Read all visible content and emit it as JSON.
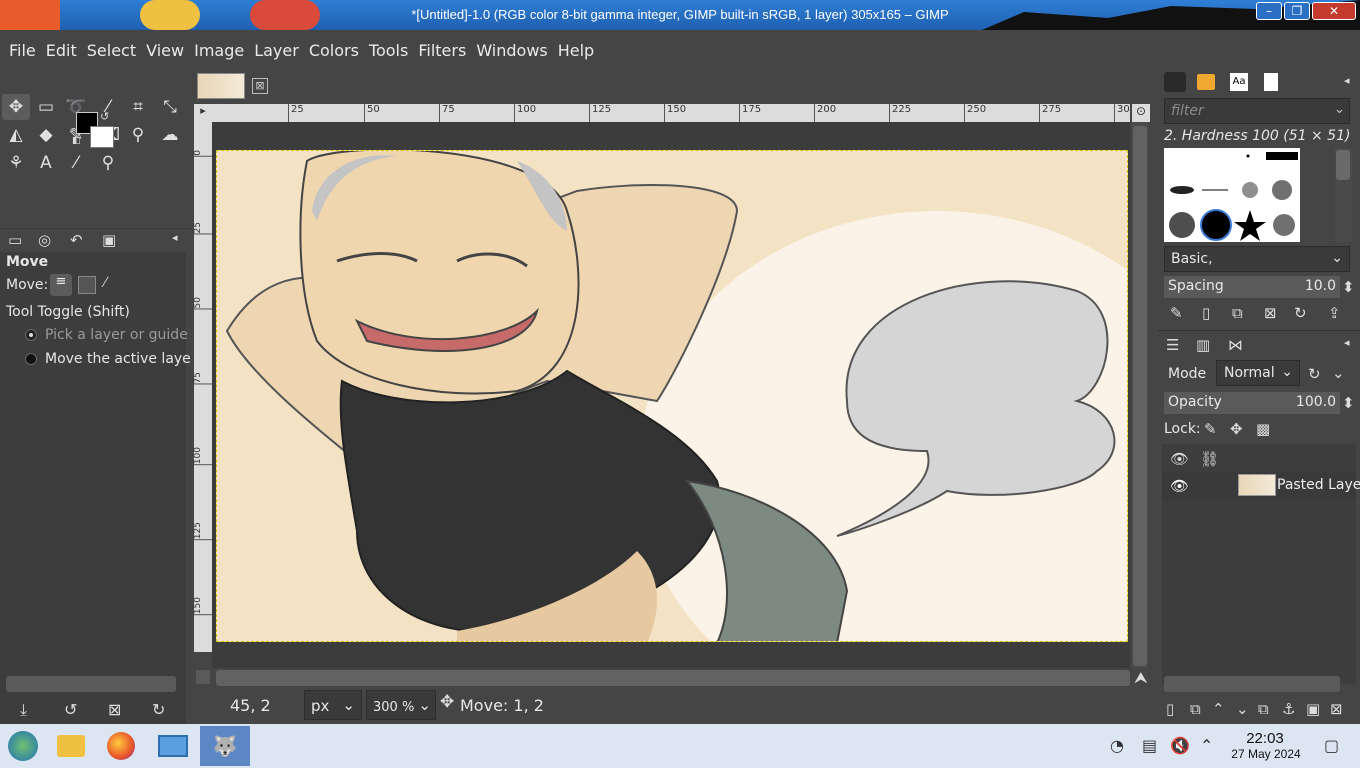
{
  "window": {
    "title": "*[Untitled]-1.0 (RGB color 8-bit gamma integer, GIMP built-in sRGB, 1 layer) 305x165 – GIMP",
    "minimize": "–",
    "maximize": "❐",
    "close": "✕"
  },
  "menu": [
    "File",
    "Edit",
    "Select",
    "View",
    "Image",
    "Layer",
    "Colors",
    "Tools",
    "Filters",
    "Windows",
    "Help"
  ],
  "colors": {
    "foreground": "#000000",
    "background": "#ffffff",
    "accent": "#d8c500"
  },
  "tool_options": {
    "title": "Move",
    "move_label": "Move:",
    "toggle_label": "Tool Toggle  (Shift)",
    "option1": "Pick a layer or guide",
    "option2": "Move the active laye"
  },
  "image_tab": {
    "close": "⊠"
  },
  "ruler": {
    "top_labels": [
      "25",
      "50",
      "75",
      "100",
      "125",
      "150",
      "175",
      "200",
      "225",
      "250",
      "275",
      "30"
    ],
    "left_labels": [
      "0",
      "25",
      "50",
      "75",
      "100",
      "125",
      "150"
    ]
  },
  "statusbar": {
    "coords": "45, 2",
    "unit": "px",
    "zoom": "300 %",
    "message": "Move: 1, 2"
  },
  "brushes": {
    "filter_placeholder": "filter",
    "selected": "2. Hardness 100 (51 × 51)",
    "preset": "Basic,",
    "spacing_label": "Spacing",
    "spacing_value": "10.0"
  },
  "layers": {
    "mode_label": "Mode",
    "mode_value": "Normal",
    "opacity_label": "Opacity",
    "opacity_value": "100.0",
    "lock_label": "Lock:",
    "items": [
      {
        "name": "Pasted Laye"
      }
    ]
  },
  "taskbar": {
    "time": "22:03",
    "date": "27 May 2024"
  }
}
